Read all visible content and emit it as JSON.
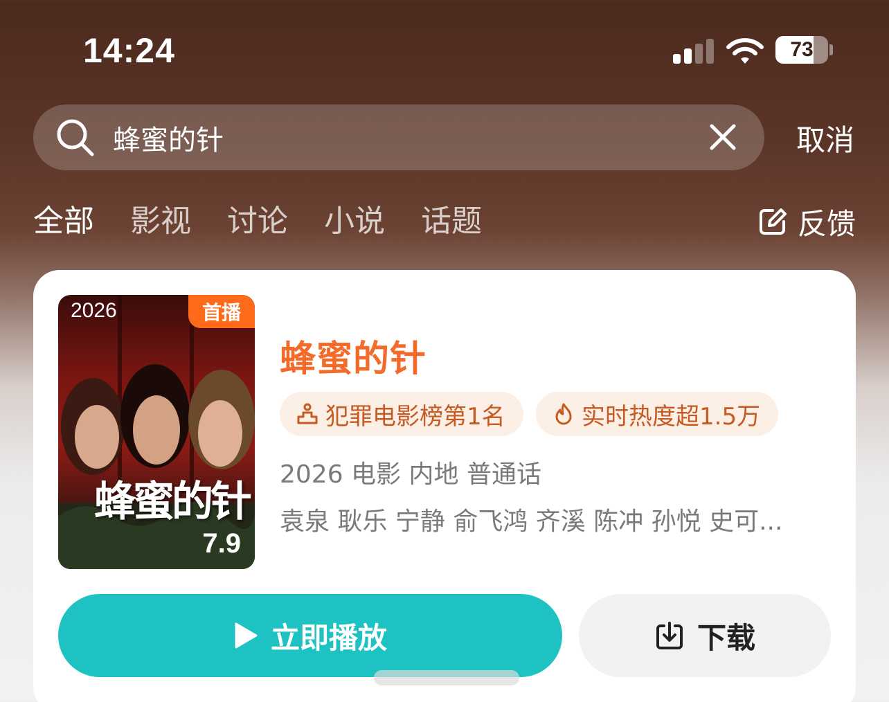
{
  "status_bar": {
    "time": "14:24",
    "battery_level": "73",
    "battery_fraction": 0.73
  },
  "search": {
    "query": "蜂蜜的针",
    "cancel_label": "取消"
  },
  "tabs": [
    {
      "label": "全部",
      "active": true
    },
    {
      "label": "影视",
      "active": false
    },
    {
      "label": "讨论",
      "active": false
    },
    {
      "label": "小说",
      "active": false
    },
    {
      "label": "话题",
      "active": false
    }
  ],
  "feedback_label": "反馈",
  "result": {
    "poster": {
      "year": "2026",
      "badge": "首播",
      "title": "蜂蜜的针",
      "score": "7.9"
    },
    "title": "蜂蜜的针",
    "tags": [
      {
        "icon": "podium-icon",
        "label": "犯罪电影榜第1名"
      },
      {
        "icon": "flame-icon",
        "label": "实时热度超1.5万"
      }
    ],
    "meta": "2026 电影 内地 普通话",
    "cast": "袁泉 耿乐 宁静 俞飞鸿 齐溪 陈冲 孙悦 史可...",
    "play_label": "立即播放",
    "download_label": "下载"
  },
  "colors": {
    "accent_orange": "#f26b2a",
    "play_teal": "#1ec2c2",
    "badge_orange": "#ff6a1a"
  }
}
